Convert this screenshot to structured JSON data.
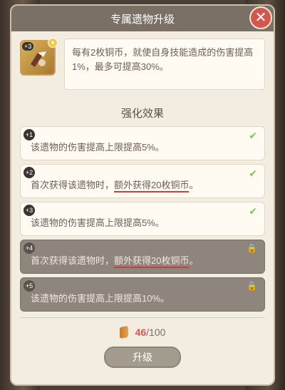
{
  "header": {
    "title": "专属遗物升级",
    "close_icon": "close-icon"
  },
  "relic": {
    "level_badge": "+3",
    "description": "每有2枚铜币，就使自身技能造成的伤害提高1%，最多可提高30%。"
  },
  "section_title": "强化效果",
  "effects": [
    {
      "num": "+1",
      "text": "该遗物的伤害提高上限提高5%。",
      "status": "check",
      "locked": false
    },
    {
      "num": "+2",
      "text_plain": "首次获得该遗物时，",
      "text_highlight": "额外获得20枚铜币",
      "text_end": "。",
      "status": "check",
      "locked": false
    },
    {
      "num": "+3",
      "text": "该遗物的伤害提高上限提高5%。",
      "status": "check",
      "locked": false
    },
    {
      "num": "+4",
      "text_plain": "首次获得该遗物时，",
      "text_highlight": "额外获得20枚铜币",
      "text_end": "。",
      "status": "lock",
      "locked": true
    },
    {
      "num": "+5",
      "text": "该遗物的伤害提高上限提高10%。",
      "status": "lock",
      "locked": true
    }
  ],
  "coins": {
    "current": "46",
    "total": "/100"
  },
  "upgrade_label": "升级",
  "colors": {
    "accent": "#d2574c",
    "check": "#7cc55a",
    "lock": "#f2c94c"
  }
}
